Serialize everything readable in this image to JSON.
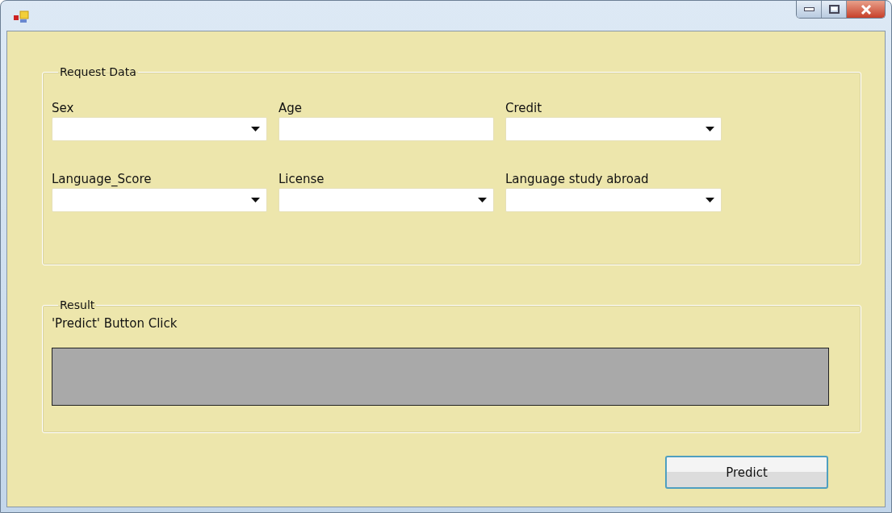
{
  "request_group": {
    "title": "Request Data",
    "fields": [
      {
        "label": "Sex",
        "kind": "combo"
      },
      {
        "label": "Age",
        "kind": "text"
      },
      {
        "label": "Credit",
        "kind": "combo"
      },
      {
        "label": "Language_Score",
        "kind": "combo"
      },
      {
        "label": "License",
        "kind": "combo"
      },
      {
        "label": "Language study abroad",
        "kind": "combo"
      }
    ]
  },
  "result_group": {
    "title": "Result",
    "caption": "'Predict' Button Click"
  },
  "buttons": [
    "Predict"
  ]
}
